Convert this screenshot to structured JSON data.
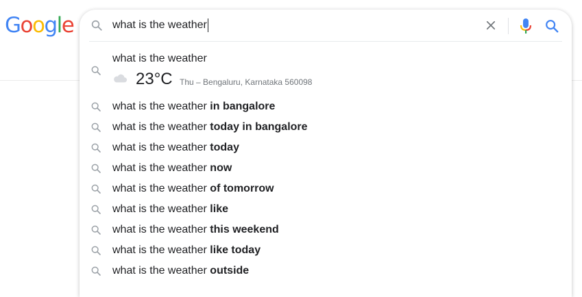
{
  "logo": {
    "letters": [
      "G",
      "o",
      "o",
      "g",
      "l",
      "e"
    ],
    "colors": [
      "#4285F4",
      "#EA4335",
      "#FBBC05",
      "#4285F4",
      "#34A853",
      "#EA4335"
    ]
  },
  "search": {
    "query": "what is the weather",
    "clear_icon": "close-icon",
    "voice_icon": "mic-icon",
    "search_icon": "search-icon"
  },
  "weather_card": {
    "title": "what is the weather",
    "temperature": "23°C",
    "meta": "Thu – Bengaluru, Karnataka 560098",
    "condition_icon": "cloud-icon"
  },
  "suggestions": [
    {
      "prefix": "what is the weather ",
      "completion": "in bangalore"
    },
    {
      "prefix": "what is the weather ",
      "completion": "today in bangalore"
    },
    {
      "prefix": "what is the weather ",
      "completion": "today"
    },
    {
      "prefix": "what is the weather ",
      "completion": "now"
    },
    {
      "prefix": "what is the weather ",
      "completion": "of tomorrow"
    },
    {
      "prefix": "what is the weather ",
      "completion": "like"
    },
    {
      "prefix": "what is the weather ",
      "completion": "this weekend"
    },
    {
      "prefix": "what is the weather ",
      "completion": "like today"
    },
    {
      "prefix": "what is the weather ",
      "completion": "outside"
    }
  ],
  "colors": {
    "mic_blue": "#4285F4",
    "mic_red": "#EA4335",
    "mic_yellow": "#FBBC05",
    "mic_green": "#34A853",
    "search_blue": "#4285F4",
    "icon_gray": "#9aa0a6"
  }
}
